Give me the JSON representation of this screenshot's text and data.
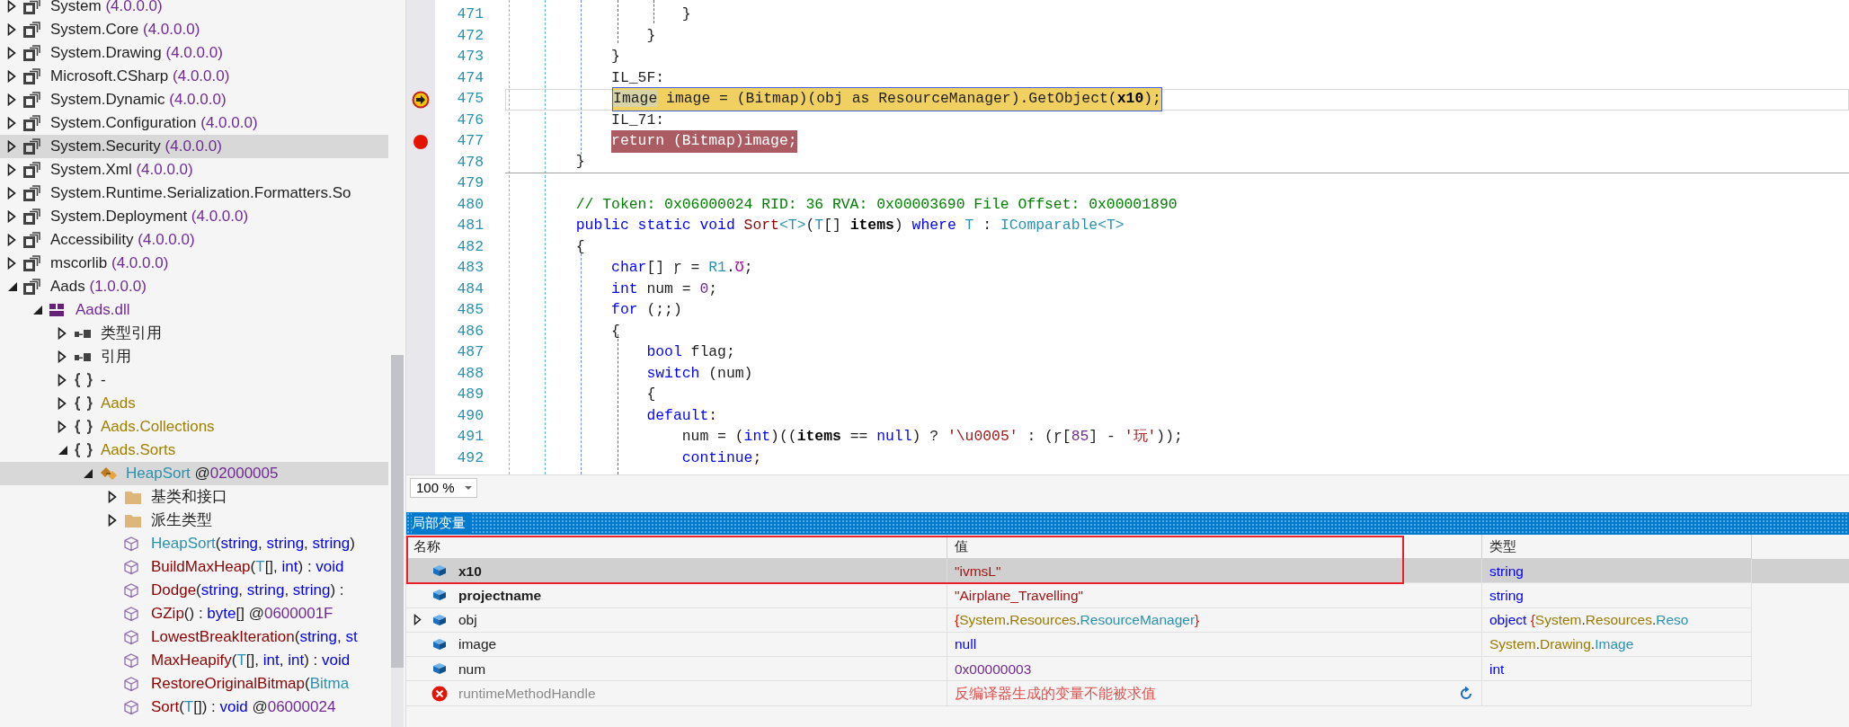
{
  "tree": [
    {
      "kind": "assembly",
      "expanded": false,
      "selected": false,
      "parts": [
        {
          "text": "System ",
          "kind": "plain"
        },
        {
          "text": "(4.0.0.0)",
          "kind": "version"
        }
      ]
    },
    {
      "kind": "assembly",
      "expanded": false,
      "selected": false,
      "parts": [
        {
          "text": "System.Core ",
          "kind": "plain"
        },
        {
          "text": "(4.0.0.0)",
          "kind": "version"
        }
      ]
    },
    {
      "kind": "assembly",
      "expanded": false,
      "selected": false,
      "parts": [
        {
          "text": "System.Drawing ",
          "kind": "plain"
        },
        {
          "text": "(4.0.0.0)",
          "kind": "version"
        }
      ]
    },
    {
      "kind": "assembly",
      "expanded": false,
      "selected": false,
      "parts": [
        {
          "text": "Microsoft.CSharp ",
          "kind": "plain"
        },
        {
          "text": "(4.0.0.0)",
          "kind": "version"
        }
      ]
    },
    {
      "kind": "assembly",
      "expanded": false,
      "selected": false,
      "parts": [
        {
          "text": "System.Dynamic ",
          "kind": "plain"
        },
        {
          "text": "(4.0.0.0)",
          "kind": "version"
        }
      ]
    },
    {
      "kind": "assembly",
      "expanded": false,
      "selected": false,
      "parts": [
        {
          "text": "System.Configuration ",
          "kind": "plain"
        },
        {
          "text": "(4.0.0.0)",
          "kind": "version"
        }
      ]
    },
    {
      "kind": "assembly",
      "expanded": false,
      "selected": true,
      "parts": [
        {
          "text": "System.Security ",
          "kind": "plain"
        },
        {
          "text": "(4.0.0.0)",
          "kind": "version"
        }
      ]
    },
    {
      "kind": "assembly",
      "expanded": false,
      "selected": false,
      "parts": [
        {
          "text": "System.Xml ",
          "kind": "plain"
        },
        {
          "text": "(4.0.0.0)",
          "kind": "version"
        }
      ]
    },
    {
      "kind": "assembly",
      "expanded": false,
      "selected": false,
      "parts": [
        {
          "text": "System.Runtime.Serialization.Formatters.So",
          "kind": "plain"
        }
      ]
    },
    {
      "kind": "assembly",
      "expanded": false,
      "selected": false,
      "parts": [
        {
          "text": "System.Deployment ",
          "kind": "plain"
        },
        {
          "text": "(4.0.0.0)",
          "kind": "version"
        }
      ]
    },
    {
      "kind": "assembly",
      "expanded": false,
      "selected": false,
      "parts": [
        {
          "text": "Accessibility ",
          "kind": "plain"
        },
        {
          "text": "(4.0.0.0)",
          "kind": "version"
        }
      ]
    },
    {
      "kind": "assembly",
      "expanded": false,
      "selected": false,
      "parts": [
        {
          "text": "mscorlib ",
          "kind": "plain"
        },
        {
          "text": "(4.0.0.0)",
          "kind": "version"
        }
      ]
    },
    {
      "kind": "assembly",
      "expanded": true,
      "selected": false,
      "parts": [
        {
          "text": "Aads ",
          "kind": "plain"
        },
        {
          "text": "(1.0.0.0)",
          "kind": "version"
        }
      ],
      "children": [
        {
          "kind": "module",
          "expanded": true,
          "selected": false,
          "parts": [
            {
              "text": "Aads.dll",
              "kind": "module"
            }
          ],
          "children": [
            {
              "kind": "references",
              "expanded": false,
              "selected": false,
              "parts": [
                {
                  "text": "类型引用",
                  "kind": "plain"
                }
              ]
            },
            {
              "kind": "references",
              "expanded": false,
              "selected": false,
              "parts": [
                {
                  "text": "引用",
                  "kind": "plain"
                }
              ]
            },
            {
              "kind": "namespace",
              "expanded": false,
              "selected": false,
              "parts": [
                {
                  "text": "-",
                  "kind": "plain"
                }
              ]
            },
            {
              "kind": "namespace",
              "expanded": false,
              "selected": false,
              "parts": [
                {
                  "text": "Aads",
                  "kind": "namespace"
                }
              ]
            },
            {
              "kind": "namespace",
              "expanded": false,
              "selected": false,
              "parts": [
                {
                  "text": "Aads.Collections",
                  "kind": "namespace"
                }
              ]
            },
            {
              "kind": "namespace",
              "expanded": true,
              "selected": false,
              "parts": [
                {
                  "text": "Aads.Sorts",
                  "kind": "namespace"
                }
              ],
              "children": [
                {
                  "kind": "class",
                  "expanded": true,
                  "selected": true,
                  "parts": [
                    {
                      "text": "HeapSort",
                      "kind": "type"
                    },
                    {
                      "text": " @",
                      "kind": "plain"
                    },
                    {
                      "text": "02000005",
                      "kind": "token"
                    }
                  ],
                  "children": [
                    {
                      "kind": "folder",
                      "expanded": false,
                      "selected": false,
                      "parts": [
                        {
                          "text": "基类和接口",
                          "kind": "plain"
                        }
                      ]
                    },
                    {
                      "kind": "folder",
                      "expanded": false,
                      "selected": false,
                      "parts": [
                        {
                          "text": "派生类型",
                          "kind": "plain"
                        }
                      ]
                    },
                    {
                      "kind": "method",
                      "selected": false,
                      "parts": [
                        {
                          "text": "HeapSort",
                          "kind": "type"
                        },
                        {
                          "text": "(",
                          "kind": "plain"
                        },
                        {
                          "text": "string",
                          "kind": "keyword"
                        },
                        {
                          "text": ", ",
                          "kind": "plain"
                        },
                        {
                          "text": "string",
                          "kind": "keyword"
                        },
                        {
                          "text": ", ",
                          "kind": "plain"
                        },
                        {
                          "text": "string",
                          "kind": "keyword"
                        },
                        {
                          "text": ")",
                          "kind": "plain"
                        }
                      ]
                    },
                    {
                      "kind": "method",
                      "selected": false,
                      "parts": [
                        {
                          "text": "BuildMaxHeap",
                          "kind": "method"
                        },
                        {
                          "text": "(",
                          "kind": "plain"
                        },
                        {
                          "text": "T",
                          "kind": "type"
                        },
                        {
                          "text": "[], ",
                          "kind": "plain"
                        },
                        {
                          "text": "int",
                          "kind": "keyword"
                        },
                        {
                          "text": ") : ",
                          "kind": "plain"
                        },
                        {
                          "text": "void",
                          "kind": "keyword"
                        }
                      ]
                    },
                    {
                      "kind": "method",
                      "selected": false,
                      "parts": [
                        {
                          "text": "Dodge",
                          "kind": "method"
                        },
                        {
                          "text": "(",
                          "kind": "plain"
                        },
                        {
                          "text": "string",
                          "kind": "keyword"
                        },
                        {
                          "text": ", ",
                          "kind": "plain"
                        },
                        {
                          "text": "string",
                          "kind": "keyword"
                        },
                        {
                          "text": ", ",
                          "kind": "plain"
                        },
                        {
                          "text": "string",
                          "kind": "keyword"
                        },
                        {
                          "text": ") :",
                          "kind": "plain"
                        }
                      ]
                    },
                    {
                      "kind": "method",
                      "selected": false,
                      "parts": [
                        {
                          "text": "GZip",
                          "kind": "method"
                        },
                        {
                          "text": "() : ",
                          "kind": "plain"
                        },
                        {
                          "text": "byte",
                          "kind": "keyword"
                        },
                        {
                          "text": "[] @",
                          "kind": "plain"
                        },
                        {
                          "text": "0600001F",
                          "kind": "token"
                        }
                      ]
                    },
                    {
                      "kind": "method",
                      "selected": false,
                      "parts": [
                        {
                          "text": "LowestBreakIteration",
                          "kind": "method"
                        },
                        {
                          "text": "(",
                          "kind": "plain"
                        },
                        {
                          "text": "string",
                          "kind": "keyword"
                        },
                        {
                          "text": ", ",
                          "kind": "plain"
                        },
                        {
                          "text": "st",
                          "kind": "keyword"
                        }
                      ]
                    },
                    {
                      "kind": "method",
                      "selected": false,
                      "parts": [
                        {
                          "text": "MaxHeapify",
                          "kind": "method"
                        },
                        {
                          "text": "(",
                          "kind": "plain"
                        },
                        {
                          "text": "T",
                          "kind": "type"
                        },
                        {
                          "text": "[], ",
                          "kind": "plain"
                        },
                        {
                          "text": "int",
                          "kind": "keyword"
                        },
                        {
                          "text": ", ",
                          "kind": "plain"
                        },
                        {
                          "text": "int",
                          "kind": "keyword"
                        },
                        {
                          "text": ") : ",
                          "kind": "plain"
                        },
                        {
                          "text": "void",
                          "kind": "keyword"
                        }
                      ]
                    },
                    {
                      "kind": "method",
                      "selected": false,
                      "parts": [
                        {
                          "text": "RestoreOriginalBitmap",
                          "kind": "method"
                        },
                        {
                          "text": "(",
                          "kind": "plain"
                        },
                        {
                          "text": "Bitma",
                          "kind": "type"
                        }
                      ]
                    },
                    {
                      "kind": "method",
                      "selected": false,
                      "parts": [
                        {
                          "text": "Sort",
                          "kind": "method"
                        },
                        {
                          "text": "(",
                          "kind": "plain"
                        },
                        {
                          "text": "T",
                          "kind": "type"
                        },
                        {
                          "text": "[]) : ",
                          "kind": "plain"
                        },
                        {
                          "text": "void",
                          "kind": "keyword"
                        },
                        {
                          "text": " @",
                          "kind": "plain"
                        },
                        {
                          "text": "06000024",
                          "kind": "token"
                        }
                      ]
                    }
                  ]
                }
              ]
            }
          ]
        }
      ]
    }
  ],
  "code": [
    {
      "number": "471",
      "tokens": [
        {
          "text": "                    }",
          "kind": "plain"
        }
      ]
    },
    {
      "number": "472",
      "tokens": [
        {
          "text": "                }",
          "kind": "plain"
        }
      ]
    },
    {
      "number": "473",
      "tokens": [
        {
          "text": "            }",
          "kind": "plain"
        }
      ]
    },
    {
      "number": "474",
      "tokens": [
        {
          "text": "            IL_5F:",
          "kind": "plain"
        }
      ]
    },
    {
      "number": "475",
      "current": true,
      "tokens": [
        {
          "text": "            Image",
          "kind": "selection"
        },
        {
          "text": " image = (Bitmap)(obj as ResourceManager).GetObject(",
          "kind": "plain"
        },
        {
          "text": "x10",
          "kind": "param"
        },
        {
          "text": ");",
          "kind": "plain"
        }
      ]
    },
    {
      "number": "476",
      "tokens": [
        {
          "text": "            IL_71:",
          "kind": "plain"
        }
      ]
    },
    {
      "number": "477",
      "breakpoint": true,
      "tokens": [
        {
          "text": "            return (Bitmap)image;",
          "kind": "plain"
        }
      ]
    },
    {
      "number": "478",
      "method_end": true,
      "tokens": [
        {
          "text": "        }",
          "kind": "plain"
        }
      ]
    },
    {
      "number": "479"
    },
    {
      "number": "480",
      "tokens": [
        {
          "text": "        // Token: 0x06000024 RID: 36 RVA: 0x00003690 File Offset: 0x00001890",
          "kind": "comment"
        }
      ]
    },
    {
      "number": "481",
      "tokens": [
        {
          "text": "        public static void ",
          "kind": "keyword"
        },
        {
          "text": "Sort",
          "kind": "method"
        },
        {
          "text": "<T>",
          "kind": "type"
        },
        {
          "text": "(",
          "kind": "plain"
        },
        {
          "text": "T",
          "kind": "type"
        },
        {
          "text": "[] ",
          "kind": "plain"
        },
        {
          "text": "items",
          "kind": "param"
        },
        {
          "text": ") ",
          "kind": "plain"
        },
        {
          "text": "where ",
          "kind": "keyword"
        },
        {
          "text": "T",
          "kind": "type"
        },
        {
          "text": " : ",
          "kind": "plain"
        },
        {
          "text": "IComparable<T>",
          "kind": "type"
        }
      ]
    },
    {
      "number": "482",
      "tokens": [
        {
          "text": "        {",
          "kind": "plain"
        }
      ]
    },
    {
      "number": "483",
      "tokens": [
        {
          "text": "            char",
          "kind": "keyword"
        },
        {
          "text": "[] ŗ = ",
          "kind": "plain"
        },
        {
          "text": "R1",
          "kind": "type"
        },
        {
          "text": ".",
          "kind": "plain"
        },
        {
          "text": "Ʊ",
          "kind": "field"
        },
        {
          "text": ";",
          "kind": "plain"
        }
      ]
    },
    {
      "number": "484",
      "tokens": [
        {
          "text": "            int",
          "kind": "keyword"
        },
        {
          "text": " num = ",
          "kind": "plain"
        },
        {
          "text": "0",
          "kind": "number"
        },
        {
          "text": ";",
          "kind": "plain"
        }
      ]
    },
    {
      "number": "485",
      "tokens": [
        {
          "text": "            for",
          "kind": "keyword"
        },
        {
          "text": " (;;)",
          "kind": "plain"
        }
      ]
    },
    {
      "number": "486",
      "tokens": [
        {
          "text": "            {",
          "kind": "plain"
        }
      ]
    },
    {
      "number": "487",
      "tokens": [
        {
          "text": "                bool",
          "kind": "keyword"
        },
        {
          "text": " flag;",
          "kind": "plain"
        }
      ]
    },
    {
      "number": "488",
      "tokens": [
        {
          "text": "                switch",
          "kind": "keyword"
        },
        {
          "text": " (num)",
          "kind": "plain"
        }
      ]
    },
    {
      "number": "489",
      "tokens": [
        {
          "text": "                {",
          "kind": "plain"
        }
      ]
    },
    {
      "number": "490",
      "tokens": [
        {
          "text": "                default",
          "kind": "keyword"
        },
        {
          "text": ":",
          "kind": "plain"
        }
      ]
    },
    {
      "number": "491",
      "tokens": [
        {
          "text": "                    num = (",
          "kind": "plain"
        },
        {
          "text": "int",
          "kind": "keyword"
        },
        {
          "text": ")((",
          "kind": "plain"
        },
        {
          "text": "items",
          "kind": "param"
        },
        {
          "text": " == ",
          "kind": "plain"
        },
        {
          "text": "null",
          "kind": "keyword"
        },
        {
          "text": ") ? ",
          "kind": "plain"
        },
        {
          "text": "'\\u0005'",
          "kind": "string"
        },
        {
          "text": " : (ŗ[",
          "kind": "plain"
        },
        {
          "text": "85",
          "kind": "number"
        },
        {
          "text": "] - ",
          "kind": "plain"
        },
        {
          "text": "'玩'",
          "kind": "string"
        },
        {
          "text": "));",
          "kind": "plain"
        }
      ]
    },
    {
      "number": "492",
      "tokens": [
        {
          "text": "                    continue",
          "kind": "keyword"
        },
        {
          "text": ";",
          "kind": "plain"
        }
      ]
    }
  ],
  "zoom": {
    "value": "100 %"
  },
  "locals": {
    "title": "局部变量",
    "columns": [
      "名称",
      "值",
      "类型"
    ],
    "rows": [
      {
        "kind": "local",
        "name": "x10",
        "bold": true,
        "selected": true,
        "expanded": null,
        "value": [
          {
            "text": "\"ivmsL\"",
            "kind": "string"
          }
        ],
        "type": [
          {
            "text": "string",
            "kind": "keyword"
          }
        ]
      },
      {
        "kind": "local",
        "name": "projectname",
        "bold": true,
        "selected": false,
        "expanded": null,
        "value": [
          {
            "text": "\"Airplane_Travelling\"",
            "kind": "string"
          }
        ],
        "type": [
          {
            "text": "string",
            "kind": "keyword"
          }
        ]
      },
      {
        "kind": "local",
        "name": "obj",
        "bold": false,
        "selected": false,
        "expanded": false,
        "value": [
          {
            "text": "{",
            "kind": "brace"
          },
          {
            "text": "System",
            "kind": "namespace"
          },
          {
            "text": ".",
            "kind": "plain"
          },
          {
            "text": "Resources",
            "kind": "namespace"
          },
          {
            "text": ".",
            "kind": "plain"
          },
          {
            "text": "ResourceManager",
            "kind": "type"
          },
          {
            "text": "}",
            "kind": "brace"
          }
        ],
        "type": [
          {
            "text": "object",
            "kind": "keyword"
          },
          {
            "text": " {",
            "kind": "brace"
          },
          {
            "text": "System",
            "kind": "namespace"
          },
          {
            "text": ".",
            "kind": "plain"
          },
          {
            "text": "Resources",
            "kind": "namespace"
          },
          {
            "text": ".",
            "kind": "plain"
          },
          {
            "text": "Reso",
            "kind": "type"
          }
        ]
      },
      {
        "kind": "local",
        "name": "image",
        "bold": false,
        "selected": false,
        "expanded": null,
        "value": [
          {
            "text": "null",
            "kind": "keyword"
          }
        ],
        "type": [
          {
            "text": "System",
            "kind": "namespace"
          },
          {
            "text": ".",
            "kind": "plain"
          },
          {
            "text": "Drawing",
            "kind": "namespace"
          },
          {
            "text": ".",
            "kind": "plain"
          },
          {
            "text": "Image",
            "kind": "type"
          }
        ]
      },
      {
        "kind": "local",
        "name": "num",
        "bold": false,
        "selected": false,
        "expanded": null,
        "value": [
          {
            "text": "0x00000003",
            "kind": "number"
          }
        ],
        "type": [
          {
            "text": "int",
            "kind": "keyword"
          }
        ]
      },
      {
        "kind": "error",
        "name": "runtimeMethodHandle",
        "bold": false,
        "selected": false,
        "expanded": null,
        "value": [
          {
            "text": "反编译器生成的变量不能被求值",
            "kind": "error"
          }
        ]
      }
    ]
  }
}
